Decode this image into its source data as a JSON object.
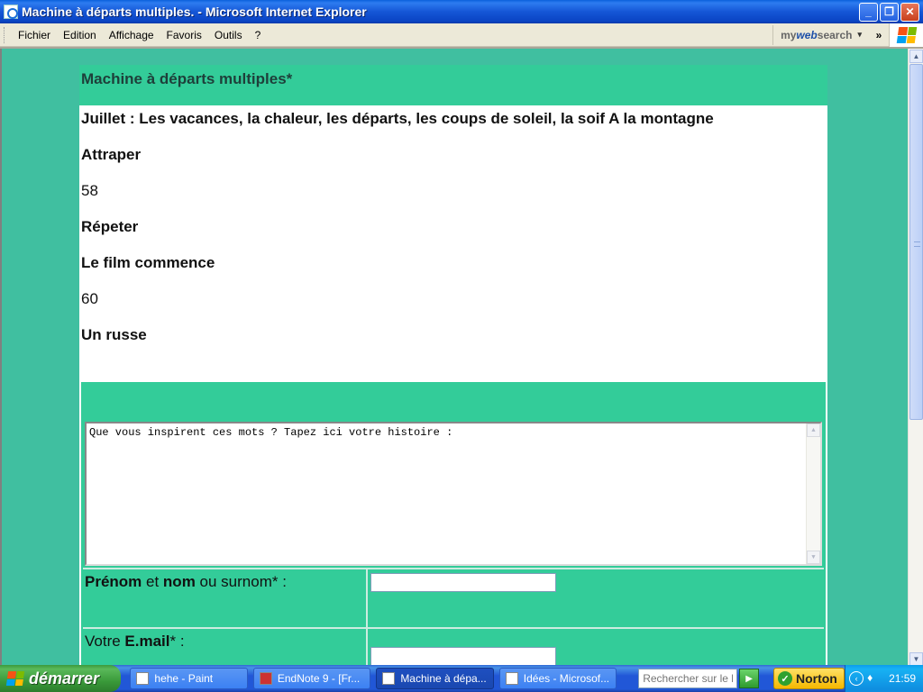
{
  "window": {
    "title": "Machine à départs multiples. - Microsoft Internet Explorer",
    "controls": {
      "minimize": "_",
      "maximize": "❐",
      "close": "✕"
    }
  },
  "menubar": {
    "items": [
      "Fichier",
      "Edition",
      "Affichage",
      "Favoris",
      "Outils",
      "?"
    ],
    "mywebsearch": {
      "my": "my",
      "web": "web",
      "search": "search",
      "arrow": "▾"
    },
    "chevron": "»"
  },
  "page": {
    "title": "Machine à départs multiples*",
    "lines": [
      {
        "text": "Juillet : Les vacances, la chaleur, les départs, les coups de soleil, la soif A la montagne",
        "bold": true
      },
      {
        "text": "Attraper",
        "bold": true
      },
      {
        "text": "58",
        "bold": false
      },
      {
        "text": "Répeter",
        "bold": true
      },
      {
        "text": "Le film commence",
        "bold": true
      },
      {
        "text": "60",
        "bold": false
      },
      {
        "text": "Un russe",
        "bold": true
      }
    ],
    "story": {
      "value": "Que vous inspirent ces mots ? Tapez ici votre histoire :"
    },
    "name_row": {
      "prenom": "Prénom",
      "et": " et ",
      "nom": "nom",
      "rest": " ou surnom* :",
      "value": ""
    },
    "email_row": {
      "votre": "Votre ",
      "email": "E.mail",
      "rest": "* :",
      "value": ""
    }
  },
  "taskbar": {
    "start_label": "démarrer",
    "tasks": [
      {
        "label": "hehe - Paint",
        "active": false
      },
      {
        "label": "EndNote 9 - [Fr...",
        "active": false
      },
      {
        "label": "Machine à dépa...",
        "active": true
      },
      {
        "label": "Idées - Microsof...",
        "active": false
      }
    ],
    "search_placeholder": "Rechercher sur le bur",
    "norton": "Norton",
    "clock": "21:59"
  },
  "colors": {
    "page_background": "#40bfa0",
    "accent_green": "#33cc99",
    "title_text": "#1e3f3a"
  }
}
